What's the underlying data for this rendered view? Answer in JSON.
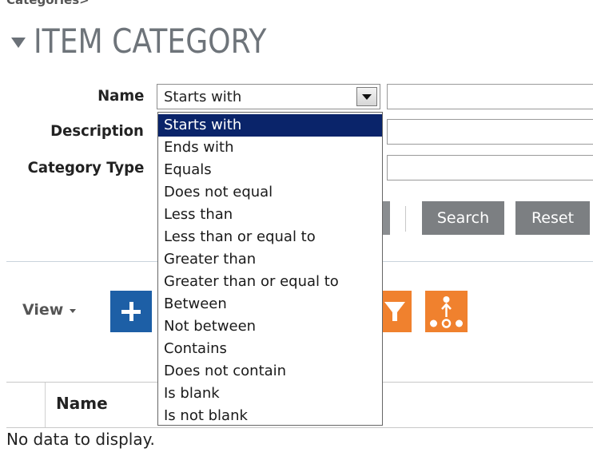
{
  "breadcrumb": "Categories>",
  "section": {
    "title": "ITEM CATEGORY"
  },
  "form": {
    "name_label": "Name",
    "description_label": "Description",
    "category_type_label": "Category Type",
    "name_operator_value": "Starts with"
  },
  "operator_options": [
    "Starts with",
    "Ends with",
    "Equals",
    "Does not equal",
    "Less than",
    "Less than or equal to",
    "Greater than",
    "Greater than or equal to",
    "Between",
    "Not between",
    "Contains",
    "Does not contain",
    "Is blank",
    "Is not blank"
  ],
  "buttons": {
    "search": "Search",
    "reset": "Reset"
  },
  "toolbar": {
    "view_label": "View"
  },
  "table": {
    "columns": [
      "Name"
    ],
    "empty_message": "No data to display."
  },
  "colors": {
    "accent_orange": "#f0812e",
    "accent_blue": "#1d5fa6",
    "selection": "#0a246a"
  },
  "icons": {
    "collapse": "triangle-down-icon",
    "add": "plus-icon",
    "filter": "filter-icon",
    "hierarchy": "hierarchy-icon"
  }
}
